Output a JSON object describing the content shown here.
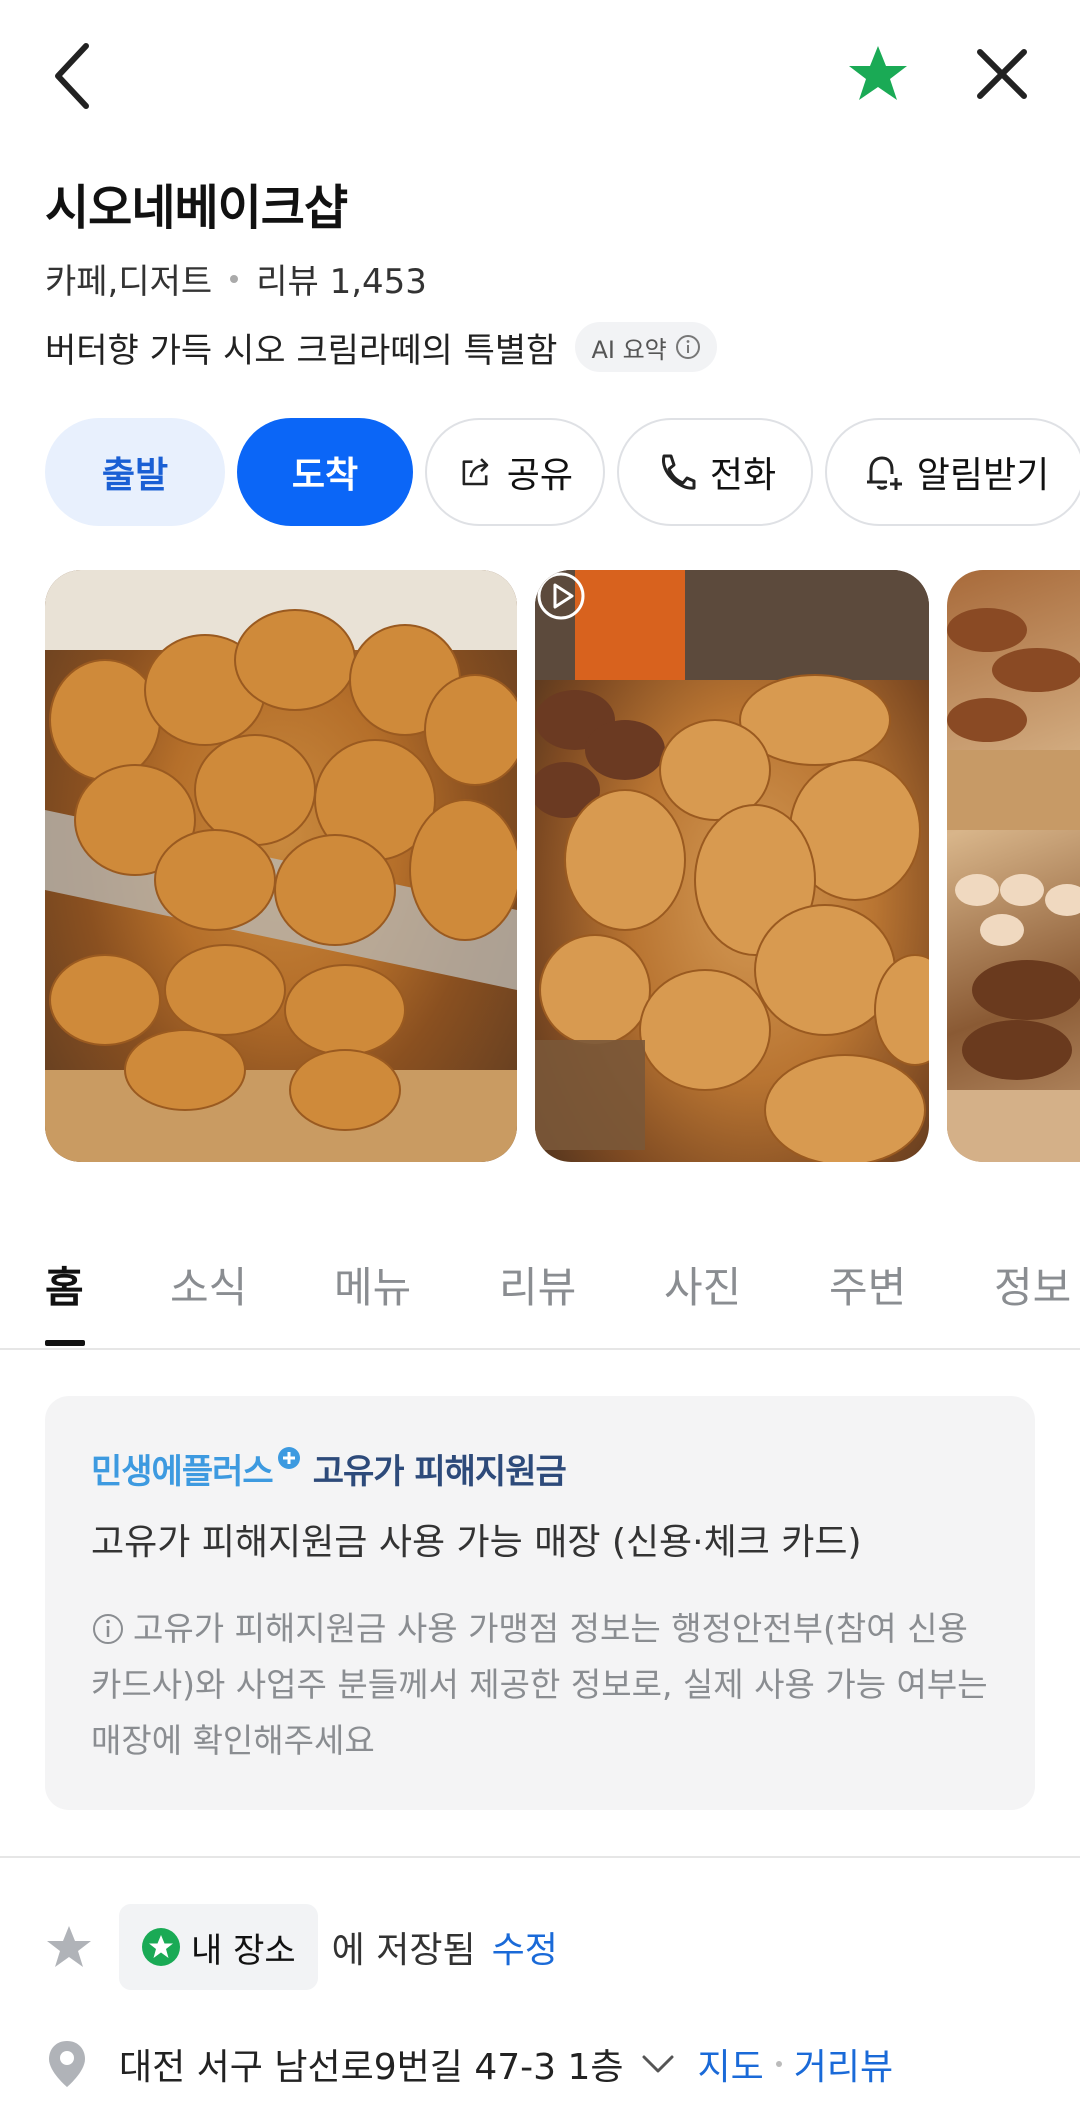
{
  "header": {
    "back_icon": "chevron-left-icon",
    "favorite_icon": "star-icon",
    "favorite_color": "#1aaa55",
    "close_icon": "close-icon"
  },
  "place": {
    "name": "시오네베이크샵",
    "category": "카페,디저트",
    "review_label": "리뷰 1,453",
    "summary": "버터향 가득 시오 크림라떼의 특별함",
    "ai_badge": "AI 요약"
  },
  "actions": {
    "depart": "출발",
    "arrive": "도착",
    "share": "공유",
    "call": "전화",
    "notify": "알림받기"
  },
  "tabs": [
    "홈",
    "소식",
    "메뉴",
    "리뷰",
    "사진",
    "주변",
    "정보"
  ],
  "active_tab": "홈",
  "notice": {
    "brand_part1": "민생에플러스",
    "brand_part2": "고유가 피해지원금",
    "headline": "고유가 피해지원금 사용 가능 매장 (신용·체크 카드)",
    "description": "고유가 피해지원금 사용 가맹점 정보는 행정안전부(참여 신용카드사)와 사업주 분들께서 제공한 정보로, 실제 사용 가능 여부는 매장에 확인해주세요"
  },
  "saved": {
    "chip_label": "내 장소",
    "saved_text": "에 저장됨",
    "edit_label": "수정"
  },
  "address": {
    "text": "대전 서구 남선로9번길 47-3 1층",
    "map_link": "지도",
    "street_view_link": "거리뷰"
  },
  "colors": {
    "primary_blue": "#0b66f7",
    "light_blue": "#e8f0fd",
    "link_blue": "#1a6ad8",
    "green": "#1aaa55"
  }
}
